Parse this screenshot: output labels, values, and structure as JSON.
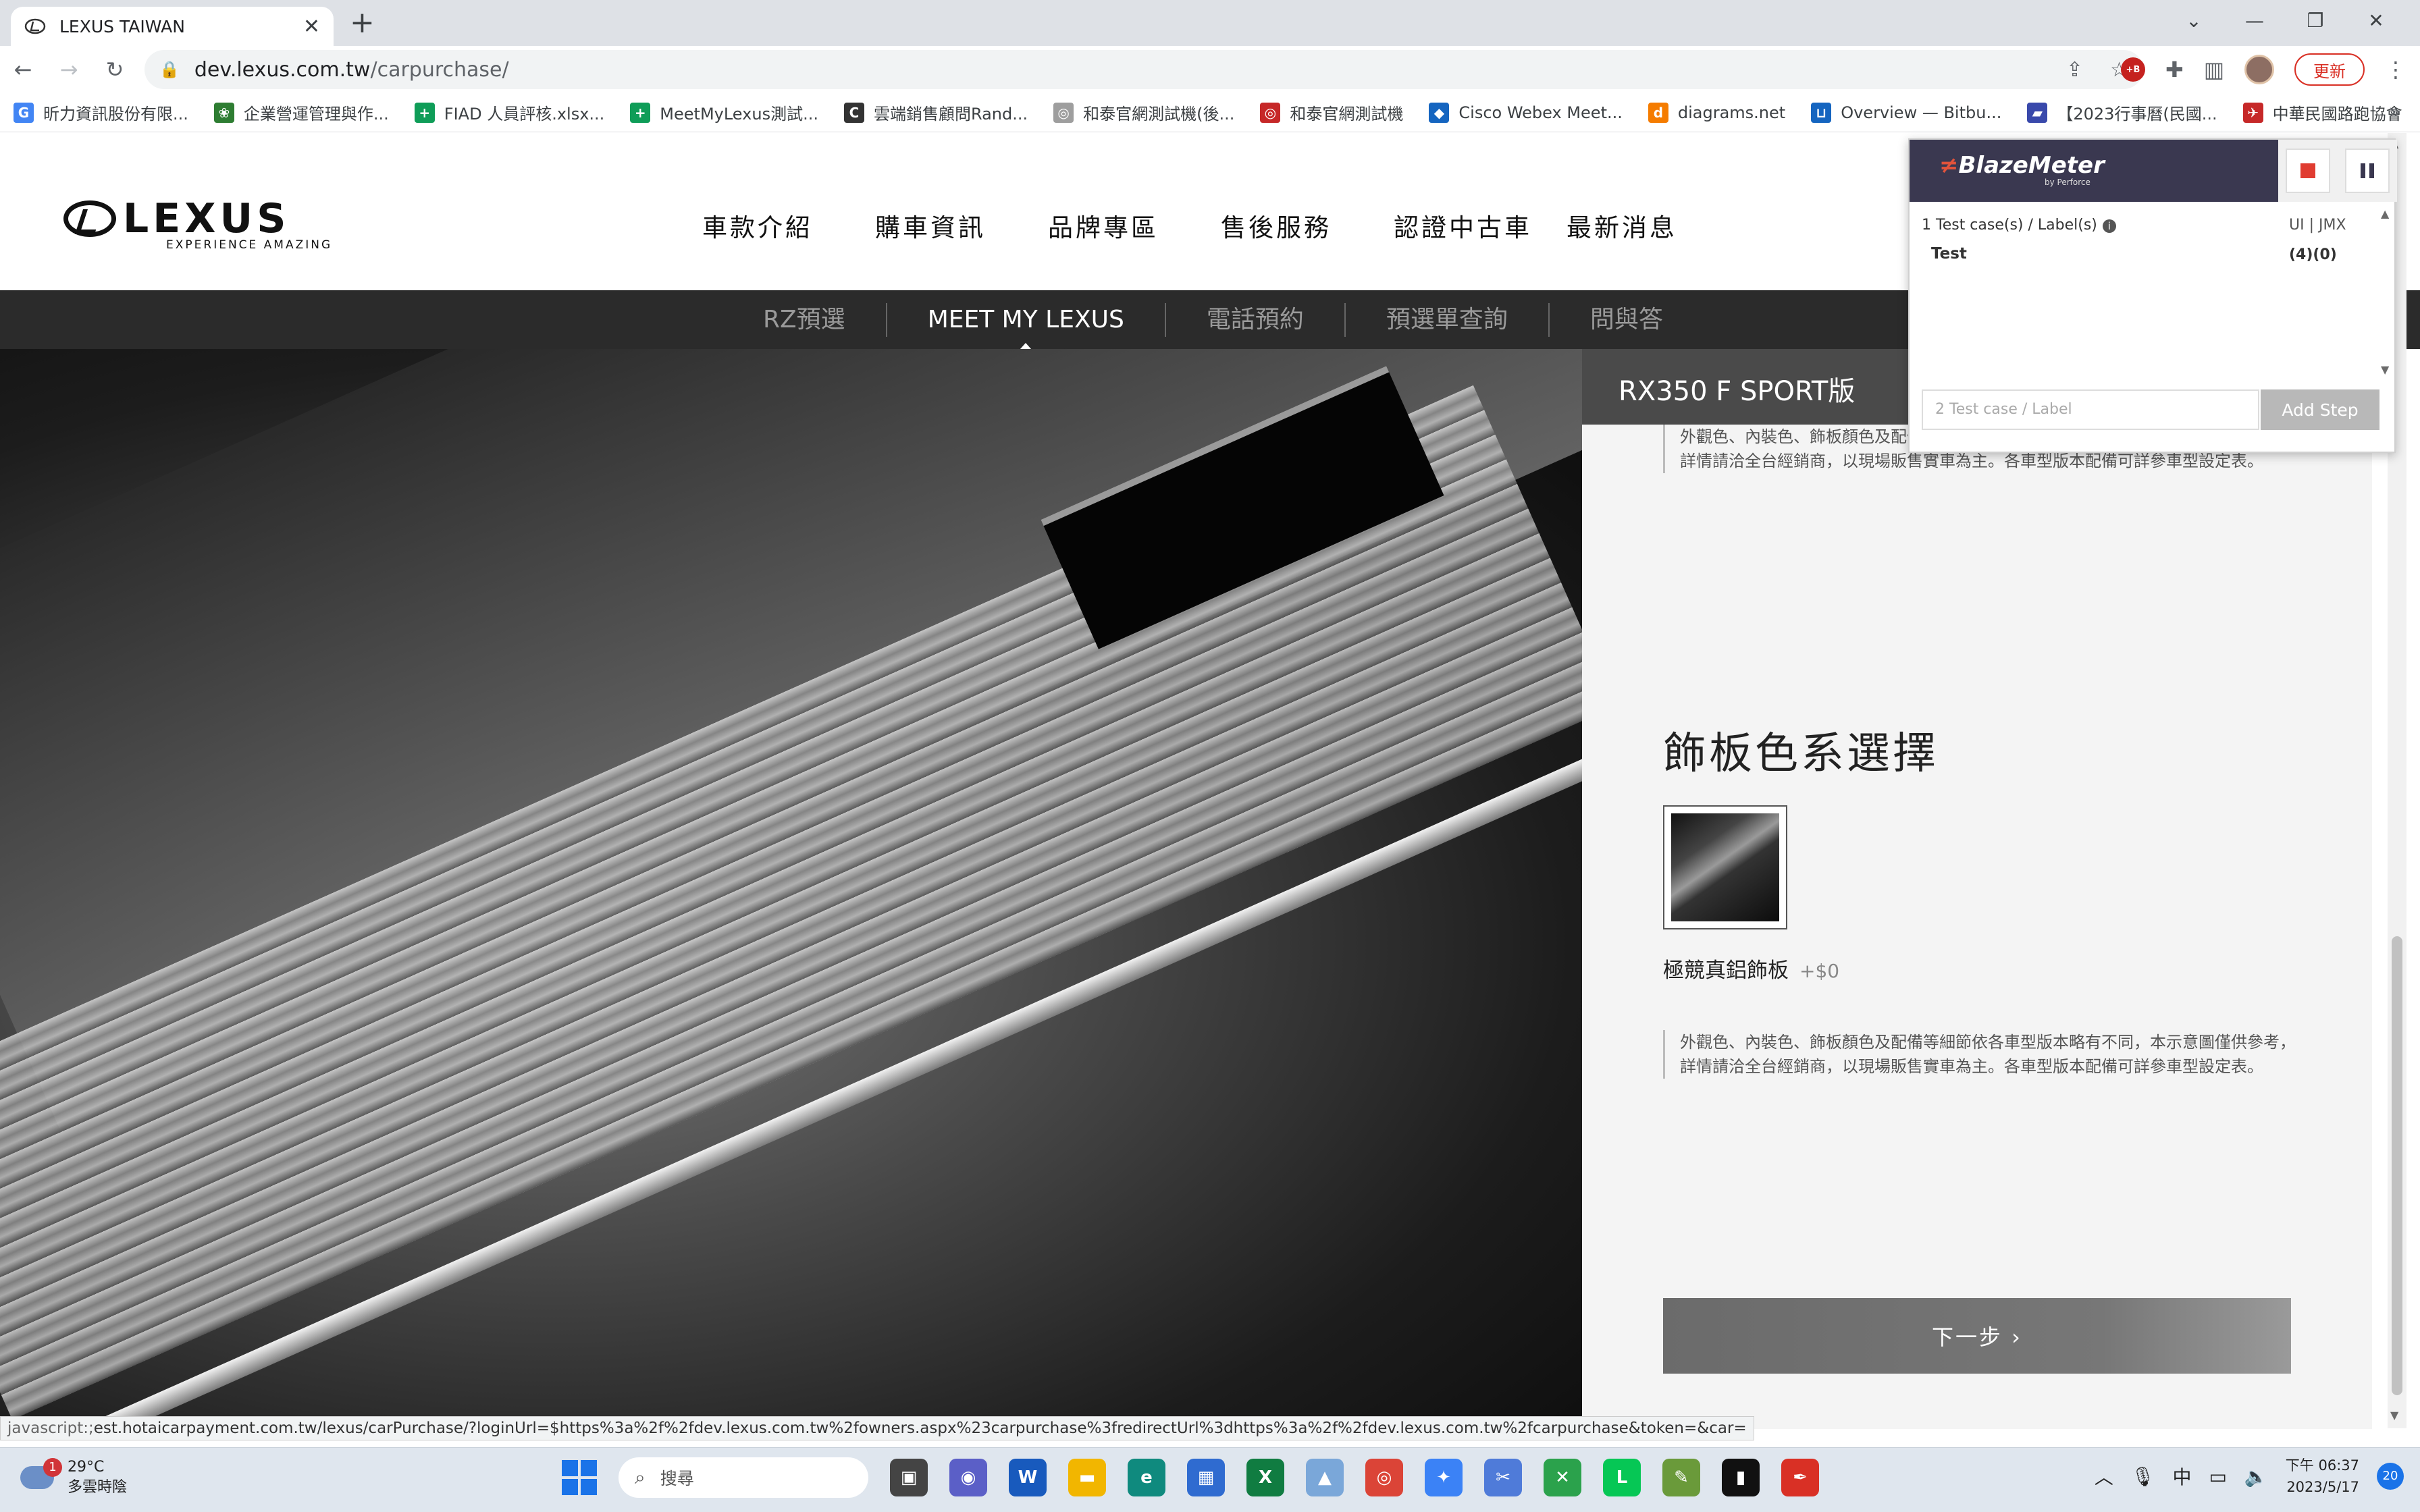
{
  "browser": {
    "tab_title": "LEXUS TAIWAN",
    "tab_close": "✕",
    "new_tab": "+",
    "window_controls": [
      "⌄",
      "—",
      "❐",
      "✕"
    ],
    "url_host": "dev.lexus.com.tw",
    "url_path": "/carpurchase/",
    "update_label": "更新",
    "ext_badge": "+B",
    "bookmarks": [
      {
        "label": "昕力資訊股份有限...",
        "icon": "G",
        "color": "#4285f4"
      },
      {
        "label": "企業營運管理與作...",
        "icon": "❀",
        "color": "#2e7d32"
      },
      {
        "label": "FIAD 人員評核.xlsx...",
        "icon": "+",
        "color": "#0f9d58"
      },
      {
        "label": "MeetMyLexus測試...",
        "icon": "+",
        "color": "#0f9d58"
      },
      {
        "label": "雲端銷售顧問Rand...",
        "icon": "C",
        "color": "#333333"
      },
      {
        "label": "和泰官網測試機(後...",
        "icon": "◎",
        "color": "#9e9e9e"
      },
      {
        "label": "和泰官網測試機",
        "icon": "◎",
        "color": "#c62828"
      },
      {
        "label": "Cisco Webex Meet...",
        "icon": "◆",
        "color": "#1565c0"
      },
      {
        "label": "diagrams.net",
        "icon": "d",
        "color": "#f57c00"
      },
      {
        "label": "Overview — Bitbu...",
        "icon": "⊔",
        "color": "#1565c0"
      },
      {
        "label": "【2023行事曆(民國...",
        "icon": "▰",
        "color": "#3949ab"
      },
      {
        "label": "中華民國路跑協會",
        "icon": "✈",
        "color": "#c62828"
      }
    ],
    "bookmarks_more": "»"
  },
  "site": {
    "logo_word": "LEXUS",
    "logo_tagline": "EXPERIENCE AMAZING",
    "main_nav": [
      "車款介紹",
      "購車資訊",
      "品牌專區",
      "售後服務",
      "認證中古車",
      "最新消息"
    ],
    "sub_nav": [
      "RZ預選",
      "MEET MY LEXUS",
      "電話預約",
      "預選單查詢",
      "問與答"
    ],
    "sub_nav_active": 1
  },
  "panel": {
    "model_name": "RX350 F SPORT版",
    "disclaimer": "外觀色、內裝色、飾板顏色及配備等細節依各車型版本略有不同，本示意圖僅供參考，詳情請洽全台經銷商，以現場販售實車為主。各車型版本配備可詳參車型設定表。",
    "section_title": "飾板色系選擇",
    "swatch_name": "極競真鋁飾板",
    "swatch_price": "+$0",
    "next_button": "下一步 ›"
  },
  "blazemeter": {
    "logo": "BlazeMeter",
    "logo_sub": "by Perforce",
    "summary": "1 Test case(s) / Label(s)",
    "format_label": "UI | JMX",
    "test_name": "Test",
    "test_count": "(4)(0)",
    "input_placeholder": "2 Test case / Label",
    "add_step": "Add Step"
  },
  "status_bar": {
    "prefix": "javascript:;",
    "url": "est.hotaicarpayment.com.tw/lexus/carPurchase/?loginUrl=$https%3a%2f%2fdev.lexus.com.tw%2fowners.aspx%23carpurchase%3fredirectUrl%3dhttps%3a%2f%2fdev.lexus.com.tw%2fcarpurchase&token=&car="
  },
  "taskbar": {
    "weather_temp": "29°C",
    "weather_desc": "多雲時陰",
    "weather_badge": "1",
    "search_placeholder": "搜尋",
    "apps": [
      {
        "name": "task-view",
        "glyph": "▣",
        "color": "#444444"
      },
      {
        "name": "teams",
        "glyph": "◉",
        "color": "#5b5fc7"
      },
      {
        "name": "word",
        "glyph": "W",
        "color": "#185abd"
      },
      {
        "name": "file-explorer",
        "glyph": "▬",
        "color": "#f2b600"
      },
      {
        "name": "edge",
        "glyph": "e",
        "color": "#0f8a7e"
      },
      {
        "name": "store",
        "glyph": "▦",
        "color": "#2f6bd0"
      },
      {
        "name": "excel",
        "glyph": "X",
        "color": "#107c41"
      },
      {
        "name": "photos",
        "glyph": "▲",
        "color": "#7aa7d9"
      },
      {
        "name": "chrome",
        "glyph": "◎",
        "color": "#db4437"
      },
      {
        "name": "wifi-tool",
        "glyph": "✦",
        "color": "#3b82f6"
      },
      {
        "name": "snipping",
        "glyph": "✂",
        "color": "#4f7bd9"
      },
      {
        "name": "tools",
        "glyph": "✕",
        "color": "#2ba24c"
      },
      {
        "name": "line",
        "glyph": "L",
        "color": "#06c755"
      },
      {
        "name": "paint",
        "glyph": "✎",
        "color": "#6a9a3a"
      },
      {
        "name": "terminal",
        "glyph": "▮",
        "color": "#111111"
      },
      {
        "name": "pen",
        "glyph": "✒",
        "color": "#d93025"
      }
    ],
    "ime": "中",
    "time": "下午 06:37",
    "date": "2023/5/17",
    "notifications": "20"
  }
}
